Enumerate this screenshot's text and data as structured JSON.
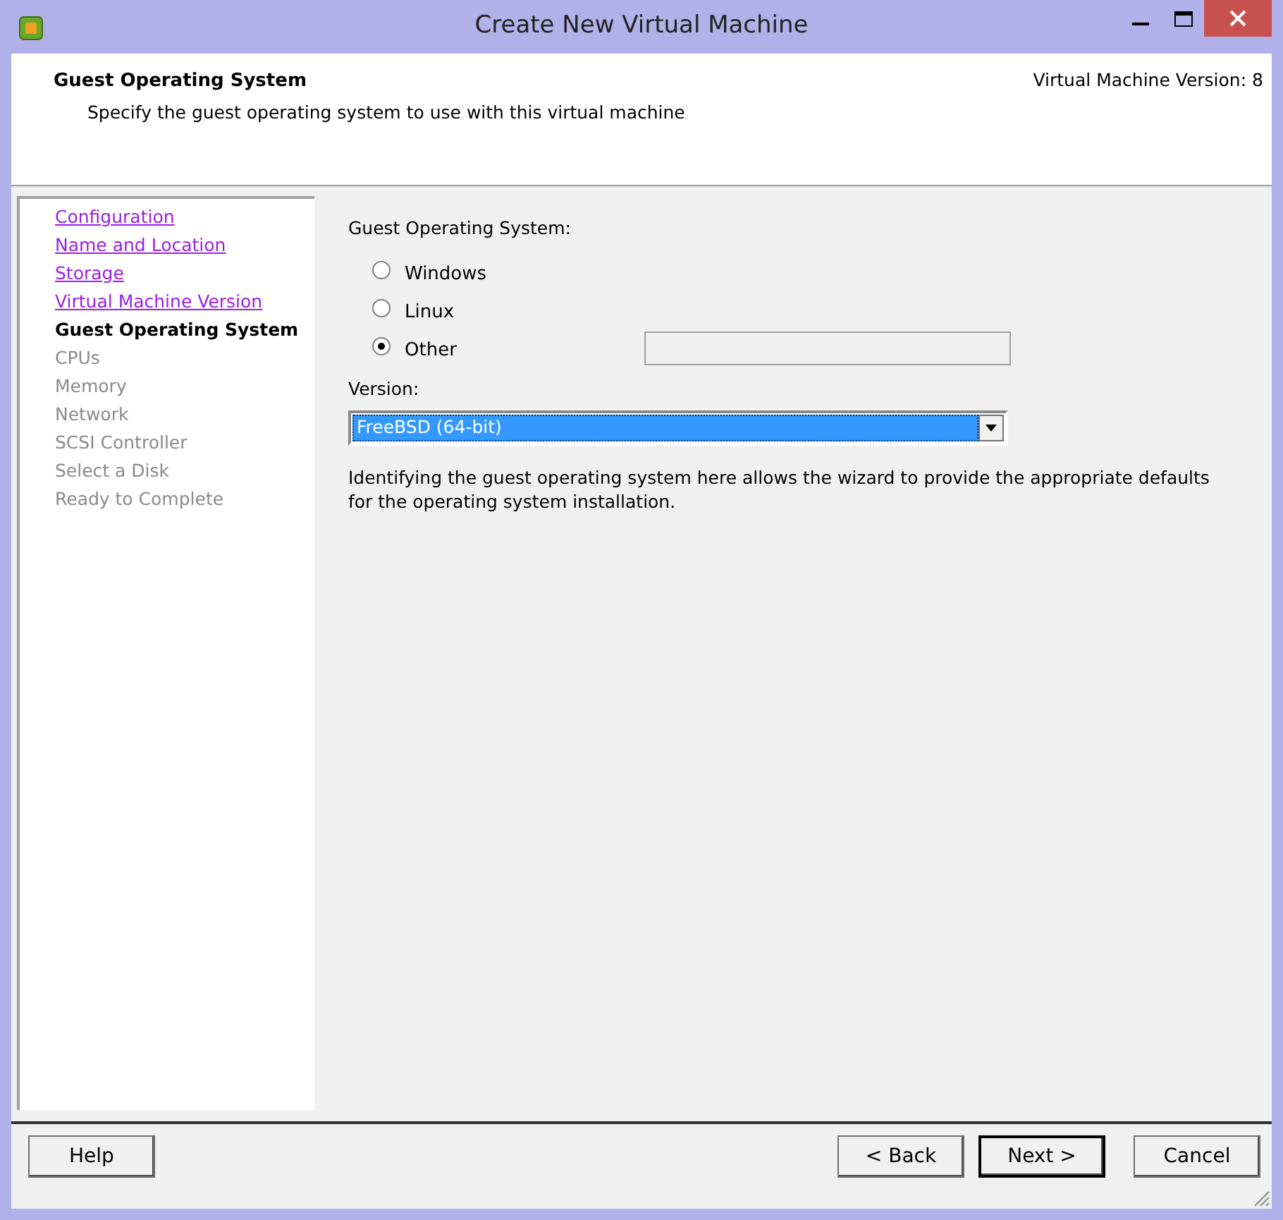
{
  "window": {
    "title": "Create New Virtual Machine"
  },
  "header": {
    "title": "Guest Operating System",
    "subtitle": "Specify the guest operating system to use with this virtual machine",
    "version": "Virtual Machine Version: 8"
  },
  "steps": [
    {
      "label": "Configuration",
      "kind": "visited"
    },
    {
      "label": "Name and Location",
      "kind": "visited"
    },
    {
      "label": "Storage",
      "kind": "visited"
    },
    {
      "label": "Virtual Machine Version",
      "kind": "visited"
    },
    {
      "label": "Guest Operating System",
      "kind": "current"
    },
    {
      "label": "CPUs",
      "kind": "pending"
    },
    {
      "label": "Memory",
      "kind": "pending"
    },
    {
      "label": "Network",
      "kind": "pending"
    },
    {
      "label": "SCSI Controller",
      "kind": "pending"
    },
    {
      "label": "Select a Disk",
      "kind": "pending"
    },
    {
      "label": "Ready to Complete",
      "kind": "pending"
    }
  ],
  "guest_os": {
    "label": "Guest Operating System:",
    "options": [
      {
        "label": "Windows",
        "selected": false
      },
      {
        "label": "Linux",
        "selected": false
      },
      {
        "label": "Other",
        "selected": true
      }
    ]
  },
  "version": {
    "label": "Version:",
    "value": "FreeBSD (64-bit)"
  },
  "description": "Identifying the guest operating system here allows the wizard to provide the appropriate defaults for the operating system installation.",
  "buttons": {
    "help": "Help",
    "back": "< Back",
    "next": "Next >",
    "cancel": "Cancel"
  }
}
